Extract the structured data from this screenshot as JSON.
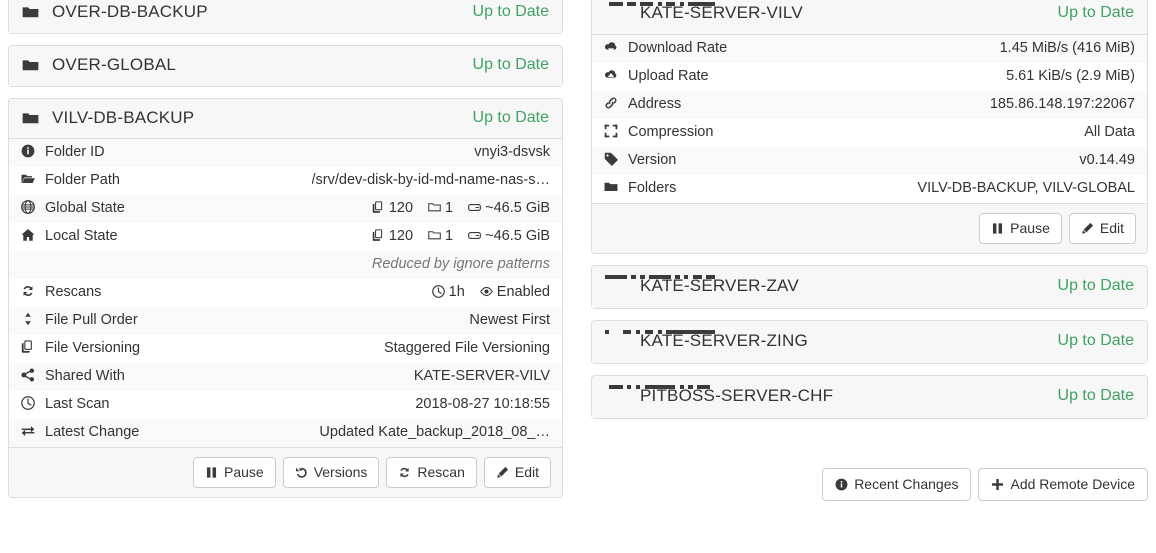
{
  "app": "Syncthing",
  "colors": {
    "status_green": "#40a163",
    "panel_border": "#dddddd",
    "heading_bg": "#f7f7f7",
    "stripe_bg": "#f9f9f9",
    "text": "#333333",
    "muted": "#777777",
    "icon_dark": "#3b3b3b"
  },
  "status_labels": {
    "up_to_date": "Up to Date"
  },
  "folders": [
    {
      "name": "OVER-DB-BACKUP",
      "icon": "folder-icon",
      "status": "Up to Date",
      "expanded": false
    },
    {
      "name": "OVER-GLOBAL",
      "icon": "folder-icon",
      "status": "Up to Date",
      "expanded": false
    },
    {
      "name": "VILV-DB-BACKUP",
      "icon": "folder-icon",
      "status": "Up to Date",
      "expanded": true,
      "details": [
        {
          "icon": "info-circle-icon",
          "key": "Folder ID",
          "value": "vnyi3-dsvsk"
        },
        {
          "icon": "folder-open-icon",
          "key": "Folder Path",
          "value": "/srv/dev-disk-by-id-md-name-nas-s…"
        },
        {
          "icon": "globe-icon",
          "key": "Global State",
          "groups": [
            {
              "icon": "files-icon",
              "value": "120"
            },
            {
              "icon": "folder-outline-icon",
              "value": "1"
            },
            {
              "icon": "hdd-icon",
              "value": "~46.5 GiB"
            }
          ]
        },
        {
          "icon": "home-icon",
          "key": "Local State",
          "groups": [
            {
              "icon": "files-icon",
              "value": "120"
            },
            {
              "icon": "folder-outline-icon",
              "value": "1"
            },
            {
              "icon": "hdd-icon",
              "value": "~46.5 GiB"
            }
          ],
          "note": "Reduced by ignore patterns"
        },
        {
          "icon": "refresh-icon",
          "key": "Rescans",
          "groups": [
            {
              "icon": "clock-icon",
              "value": "1h"
            },
            {
              "icon": "eye-icon",
              "value": "Enabled"
            }
          ]
        },
        {
          "icon": "sort-icon",
          "key": "File Pull Order",
          "value": "Newest First"
        },
        {
          "icon": "files-icon",
          "key": "File Versioning",
          "value": "Staggered File Versioning"
        },
        {
          "icon": "share-icon",
          "key": "Shared With",
          "value": "KATE-SERVER-VILV"
        },
        {
          "icon": "clock-icon",
          "key": "Last Scan",
          "value": "2018-08-27 10:18:55"
        },
        {
          "icon": "exchange-icon",
          "key": "Latest Change",
          "value": "Updated Kate_backup_2018_08_…"
        }
      ],
      "footer_buttons": [
        {
          "icon": "pause-icon",
          "label": "Pause"
        },
        {
          "icon": "history-icon",
          "label": "Versions"
        },
        {
          "icon": "refresh-icon",
          "label": "Rescan"
        },
        {
          "icon": "pencil-icon",
          "label": "Edit"
        }
      ]
    }
  ],
  "devices": [
    {
      "name": "KATE-SERVER-VILV",
      "icon": "identicon",
      "identicon": [
        [
          0,
          1,
          1,
          1,
          0
        ],
        [
          1,
          1,
          0,
          1,
          1
        ],
        [
          1,
          0,
          1,
          0,
          1
        ],
        [
          1,
          0,
          1,
          0,
          1
        ],
        [
          1,
          1,
          1,
          1,
          1
        ]
      ],
      "status": "Up to Date",
      "expanded": true,
      "details": [
        {
          "icon": "cloud-download-icon",
          "key": "Download Rate",
          "value": "1.45 MiB/s (416 MiB)"
        },
        {
          "icon": "cloud-upload-icon",
          "key": "Upload Rate",
          "value": "5.61 KiB/s (2.9 MiB)"
        },
        {
          "icon": "link-icon",
          "key": "Address",
          "value": "185.86.148.197:22067"
        },
        {
          "icon": "compress-icon",
          "key": "Compression",
          "value": "All Data"
        },
        {
          "icon": "tag-icon",
          "key": "Version",
          "value": "v0.14.49"
        },
        {
          "icon": "folder-icon",
          "key": "Folders",
          "value": "VILV-DB-BACKUP, VILV-GLOBAL"
        }
      ],
      "footer_buttons": [
        {
          "icon": "pause-icon",
          "label": "Pause"
        },
        {
          "icon": "pencil-icon",
          "label": "Edit"
        }
      ]
    },
    {
      "name": "KATE-SERVER-ZAV",
      "icon": "identicon",
      "identicon": [
        [
          1,
          1,
          1,
          1,
          1
        ],
        [
          0,
          1,
          0,
          1,
          0
        ],
        [
          1,
          1,
          1,
          1,
          1
        ],
        [
          0,
          1,
          0,
          1,
          0
        ],
        [
          1,
          1,
          0,
          1,
          1
        ]
      ],
      "status": "Up to Date",
      "expanded": false
    },
    {
      "name": "KATE-SERVER-ZING",
      "icon": "identicon",
      "identicon": [
        [
          1,
          0,
          0,
          0,
          1
        ],
        [
          1,
          0,
          1,
          0,
          1
        ],
        [
          1,
          0,
          1,
          0,
          1
        ],
        [
          1,
          1,
          1,
          1,
          1
        ],
        [
          1,
          1,
          1,
          1,
          1
        ]
      ],
      "status": "Up to Date",
      "expanded": false
    },
    {
      "name": "PITBOSS-SERVER-CHF",
      "icon": "identicon",
      "identicon": [
        [
          0,
          1,
          1,
          1,
          0
        ],
        [
          1,
          0,
          1,
          0,
          1
        ],
        [
          1,
          1,
          1,
          1,
          1
        ],
        [
          1,
          0,
          1,
          0,
          1
        ],
        [
          0,
          1,
          1,
          1,
          0
        ]
      ],
      "status": "Up to Date",
      "expanded": false
    }
  ],
  "bottom_actions": [
    {
      "icon": "info-circle-icon",
      "label": "Recent Changes"
    },
    {
      "icon": "plus-icon",
      "label": "Add Remote Device"
    }
  ]
}
